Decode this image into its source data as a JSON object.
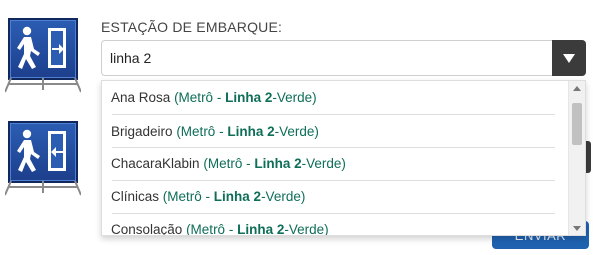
{
  "form": {
    "label": "ESTAÇÃO DE EMBARQUE:",
    "search_value": "linha 2",
    "send_label": "ENVIAR"
  },
  "results": [
    {
      "name": "Ana Rosa",
      "pre": "(Metrô - ",
      "line": "Linha 2",
      "post": "-Verde)"
    },
    {
      "name": "Brigadeiro",
      "pre": "(Metrô - ",
      "line": "Linha 2",
      "post": "-Verde)"
    },
    {
      "name": "ChacaraKlabin",
      "pre": "(Metrô - ",
      "line": "Linha 2",
      "post": "-Verde)"
    },
    {
      "name": "Clínicas",
      "pre": "(Metrô - ",
      "line": "Linha 2",
      "post": "-Verde)"
    },
    {
      "name": "Consolação",
      "pre": "(Metrô - ",
      "line": "Linha 2",
      "post": "-Verde)"
    }
  ],
  "icons": {
    "boarding_sign": "exit-sign-arrow-right-icon",
    "alighting_sign": "exit-sign-arrow-left-icon",
    "dropdown": "caret-down-icon"
  },
  "colors": {
    "accent": "#1f63b0",
    "metro_text": "#0e6e58",
    "sign_blue": "#2b5db3"
  }
}
